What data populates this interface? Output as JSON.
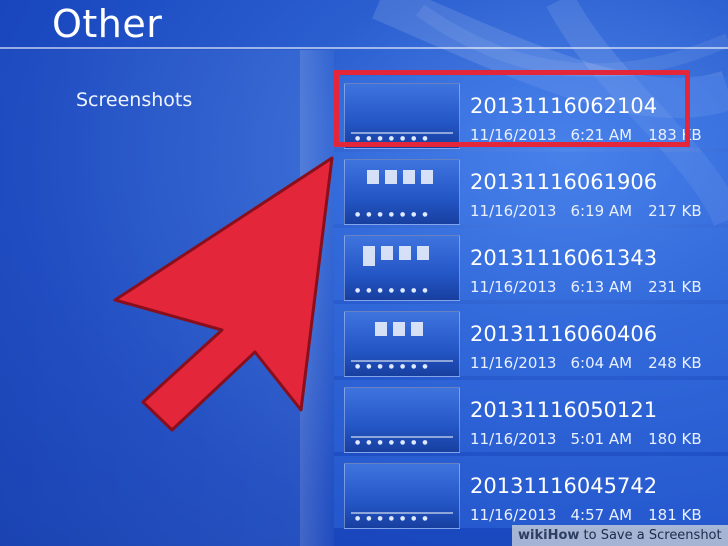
{
  "header": {
    "title": "Other"
  },
  "sidebar": {
    "category_label": "Screenshots"
  },
  "screenshots": [
    {
      "name": "20131116062104",
      "date": "11/16/2013",
      "time": "6:21 AM",
      "size": "183 KB"
    },
    {
      "name": "20131116061906",
      "date": "11/16/2013",
      "time": "6:19 AM",
      "size": "217 KB"
    },
    {
      "name": "20131116061343",
      "date": "11/16/2013",
      "time": "6:13 AM",
      "size": "231 KB"
    },
    {
      "name": "20131116060406",
      "date": "11/16/2013",
      "time": "6:04 AM",
      "size": "248 KB"
    },
    {
      "name": "20131116050121",
      "date": "11/16/2013",
      "time": "5:01 AM",
      "size": "180 KB"
    },
    {
      "name": "20131116045742",
      "date": "11/16/2013",
      "time": "4:57 AM",
      "size": "181 KB"
    }
  ],
  "annotation": {
    "highlight_color": "#e3263a",
    "arrow_color": "#e3263a"
  },
  "watermark": {
    "brand": "wikiHow",
    "text": "to Save a Screenshot"
  },
  "colors": {
    "background": "#1a48bf",
    "text": "#ffffff"
  }
}
